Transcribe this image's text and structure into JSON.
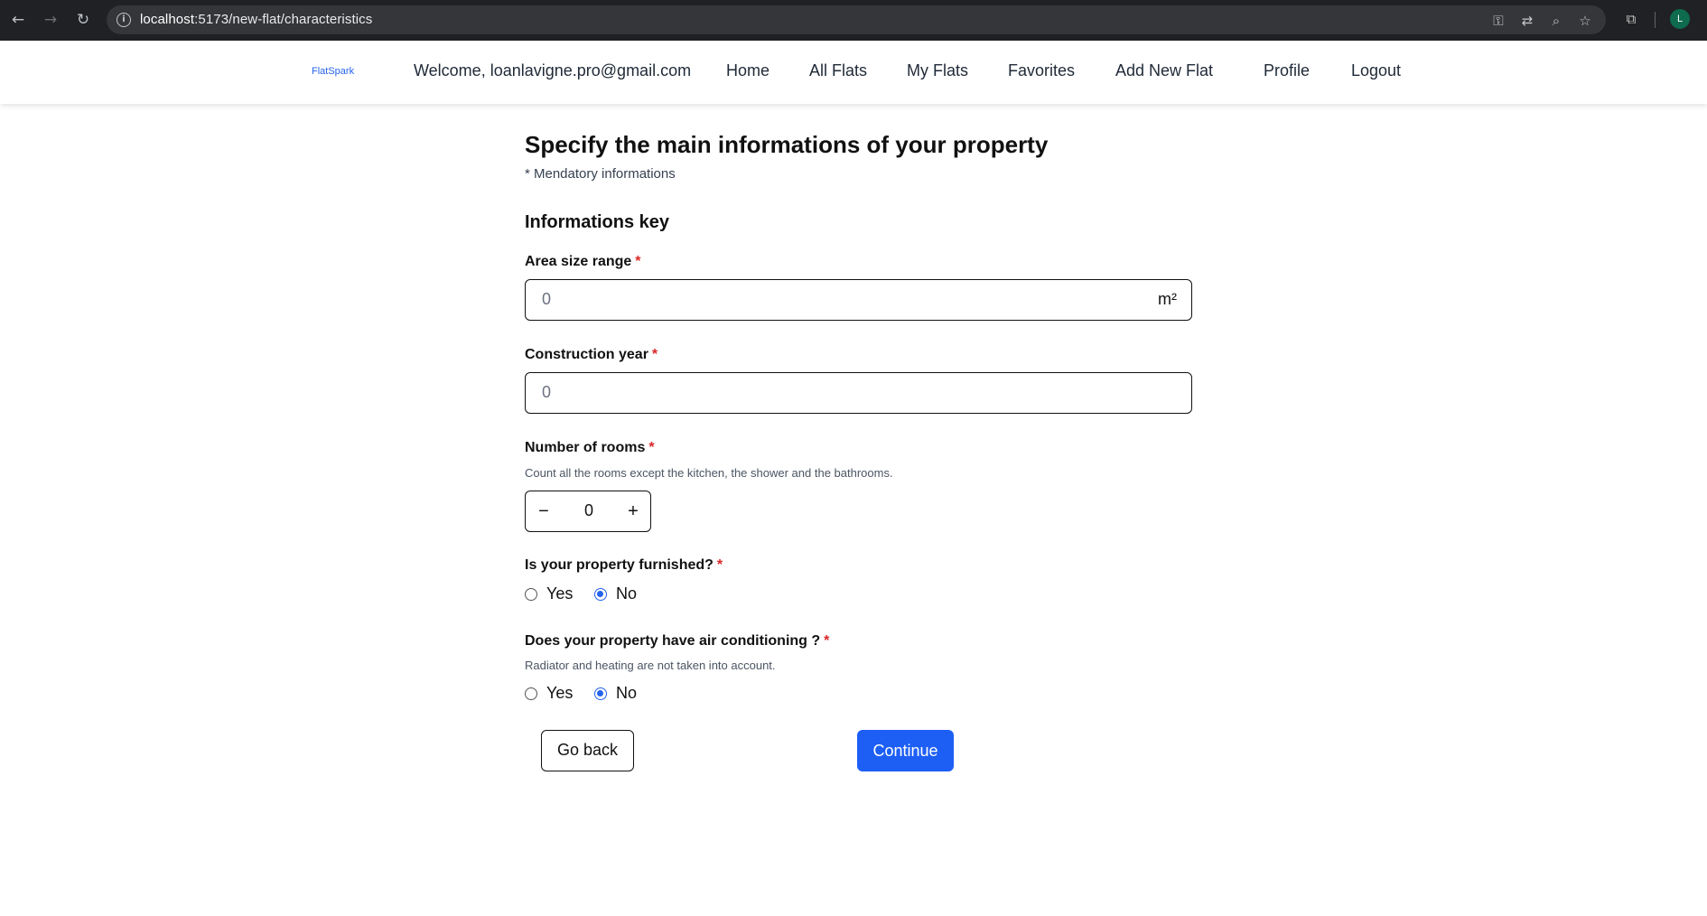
{
  "browser": {
    "url_host": "localhost",
    "url_rest": ":5173/new-flat/characteristics",
    "profile_initial": "L"
  },
  "header": {
    "logo": "FlatSpark",
    "welcome": "Welcome, loanlavigne.pro@gmail.com",
    "nav": {
      "home": "Home",
      "all_flats": "All Flats",
      "my_flats": "My Flats",
      "favorites": "Favorites",
      "add_new_flat": "Add New Flat",
      "profile": "Profile",
      "logout": "Logout"
    }
  },
  "form": {
    "title": "Specify the main informations of your property",
    "mandatory_note": "* Mendatory informations",
    "section_title": "Informations key",
    "required_mark": "*",
    "area": {
      "label": "Area size range",
      "placeholder": "0",
      "unit": "m²"
    },
    "construction_year": {
      "label": "Construction year",
      "placeholder": "0"
    },
    "rooms": {
      "label": "Number of rooms",
      "hint": "Count all the rooms except the kitchen, the shower and the bathrooms.",
      "value": "0",
      "minus": "−",
      "plus": "+"
    },
    "furnished": {
      "label": "Is your property furnished?",
      "options": [
        "Yes",
        "No"
      ],
      "selected": "No"
    },
    "air_conditioning": {
      "label": "Does your property have air conditioning ?",
      "hint": "Radiator and heating are not taken into account.",
      "options": [
        "Yes",
        "No"
      ],
      "selected": "No"
    },
    "buttons": {
      "back": "Go back",
      "continue": "Continue"
    }
  },
  "colors": {
    "accent": "#1d5ff5",
    "required": "#dc2626",
    "logo": "#2563eb"
  }
}
